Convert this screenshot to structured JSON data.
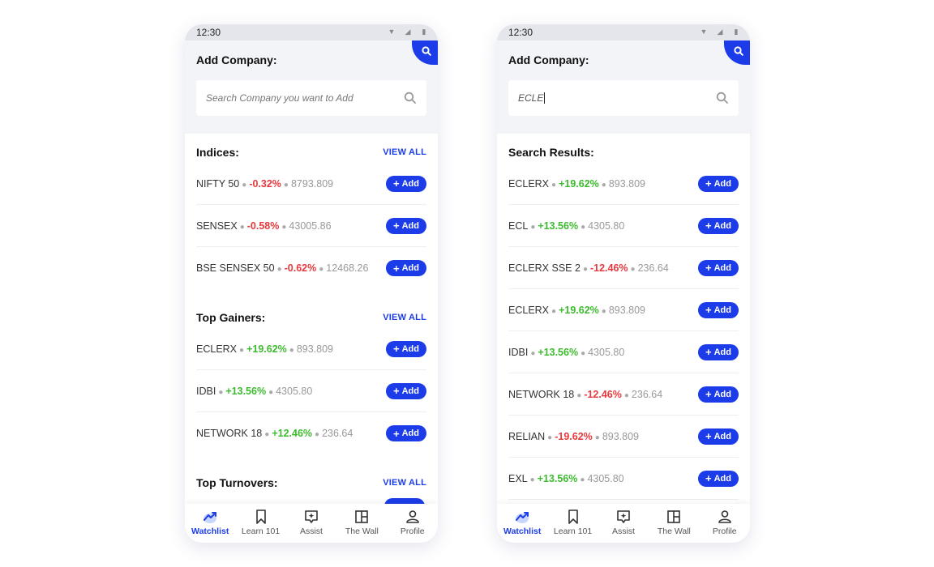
{
  "left": {
    "status": {
      "time": "12:30"
    },
    "header": {
      "title": "Add Company:",
      "search_placeholder": "Search Company you want to Add"
    },
    "sections": [
      {
        "title": "Indices:",
        "view_all": "VIEW ALL",
        "rows": [
          {
            "name": "NIFTY 50",
            "change": "-0.32%",
            "value": "8793.809",
            "dir": "neg"
          },
          {
            "name": "SENSEX",
            "change": "-0.58%",
            "value": "43005.86",
            "dir": "neg"
          },
          {
            "name": "BSE SENSEX 50",
            "change": "-0.62%",
            "value": "12468.26",
            "dir": "neg"
          }
        ]
      },
      {
        "title": "Top Gainers:",
        "view_all": "VIEW ALL",
        "rows": [
          {
            "name": "ECLERX",
            "change": "+19.62%",
            "value": "893.809",
            "dir": "pos"
          },
          {
            "name": "IDBI",
            "change": "+13.56%",
            "value": "4305.80",
            "dir": "pos"
          },
          {
            "name": "NETWORK 18",
            "change": "+12.46%",
            "value": "236.64",
            "dir": "pos"
          }
        ]
      },
      {
        "title": "Top Turnovers:",
        "view_all": "VIEW ALL",
        "rows": []
      }
    ]
  },
  "right": {
    "status": {
      "time": "12:30"
    },
    "header": {
      "title": "Add Company:",
      "search_value": "ECLE"
    },
    "results_title": "Search Results:",
    "rows": [
      {
        "name": "ECLERX",
        "change": "+19.62%",
        "value": "893.809",
        "dir": "pos"
      },
      {
        "name": "ECL",
        "change": "+13.56%",
        "value": "4305.80",
        "dir": "pos"
      },
      {
        "name": "ECLERX SSE 2",
        "change": "-12.46%",
        "value": "236.64",
        "dir": "neg"
      },
      {
        "name": "ECLERX",
        "change": "+19.62%",
        "value": "893.809",
        "dir": "pos"
      },
      {
        "name": "IDBI",
        "change": "+13.56%",
        "value": "4305.80",
        "dir": "pos"
      },
      {
        "name": "NETWORK 18",
        "change": "-12.46%",
        "value": "236.64",
        "dir": "neg"
      },
      {
        "name": "RELIAN",
        "change": "-19.62%",
        "value": "893.809",
        "dir": "neg"
      },
      {
        "name": "EXL",
        "change": "+13.56%",
        "value": "4305.80",
        "dir": "pos"
      }
    ]
  },
  "add_label": "Add",
  "nav": [
    {
      "label": "Watchlist",
      "icon": "trend-chart-icon",
      "active": true
    },
    {
      "label": "Learn 101",
      "icon": "bookmark-icon",
      "active": false
    },
    {
      "label": "Assist",
      "icon": "assist-icon",
      "active": false
    },
    {
      "label": "The Wall",
      "icon": "wall-icon",
      "active": false
    },
    {
      "label": "Profile",
      "icon": "profile-icon",
      "active": false
    }
  ],
  "colors": {
    "accent": "#1b3ce8",
    "positive": "#3dbb2f",
    "negative": "#e8383d",
    "panel": "#f3f4f8"
  }
}
